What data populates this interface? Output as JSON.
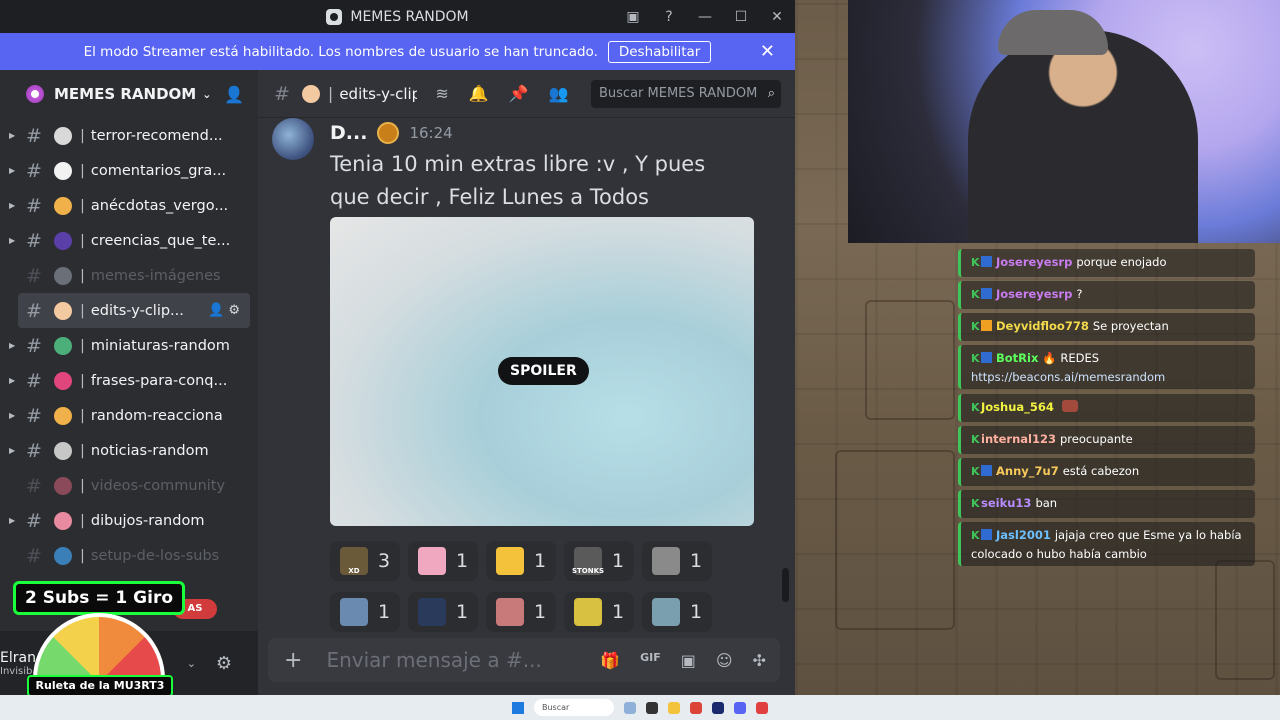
{
  "window": {
    "title": "MEMES RANDOM",
    "controls": [
      "▣",
      "?",
      "—",
      "☐",
      "✕"
    ]
  },
  "streamer_bar": {
    "message": "El modo Streamer está habilitado. Los nombres de usuario se han truncado.",
    "button": "Deshabilitar"
  },
  "server": {
    "name": "MEMES RANDOM"
  },
  "channels": [
    {
      "name": "terror-recomend...",
      "emoji_color": "#d9d9d9",
      "muted": false,
      "active": false
    },
    {
      "name": "comentarios_gra...",
      "emoji_color": "#f2f2f2",
      "muted": false,
      "active": false
    },
    {
      "name": "anécdotas_vergo...",
      "emoji_color": "#f0b04a",
      "muted": false,
      "active": false
    },
    {
      "name": "creencias_que_te...",
      "emoji_color": "#5b3fa8",
      "muted": false,
      "active": false
    },
    {
      "name": "memes-imágenes",
      "emoji_color": "#6b6f78",
      "muted": true,
      "active": false
    },
    {
      "name": "edits-y-clip...",
      "emoji_color": "#f2c9a0",
      "muted": false,
      "active": true
    },
    {
      "name": "miniaturas-random",
      "emoji_color": "#4caf7a",
      "muted": false,
      "active": false
    },
    {
      "name": "frases-para-conq...",
      "emoji_color": "#e0457b",
      "muted": false,
      "active": false
    },
    {
      "name": "random-reacciona",
      "emoji_color": "#f0b04a",
      "muted": false,
      "active": false
    },
    {
      "name": "noticias-random",
      "emoji_color": "#c7c7c7",
      "muted": false,
      "active": false
    },
    {
      "name": "videos-community",
      "emoji_color": "#8a4a5a",
      "muted": true,
      "active": false
    },
    {
      "name": "dibujos-random",
      "emoji_color": "#e88aa0",
      "muted": false,
      "active": false
    },
    {
      "name": "setup-de-los-subs",
      "emoji_color": "#3a7fb8",
      "muted": true,
      "active": false
    }
  ],
  "user": {
    "name": "Elran",
    "status": "Invisib"
  },
  "header": {
    "channel": "edits-y-clip",
    "search_placeholder": "Buscar MEMES RANDOM"
  },
  "message": {
    "author": "D...",
    "time": "16:24",
    "text": "Tenia 10 min extras libre :v , Y pues que decir , Feliz Lunes a Todos",
    "spoiler_label": "SPOILER"
  },
  "reactions": [
    {
      "count": "3",
      "color": "#6b5a3a",
      "label": "XD"
    },
    {
      "count": "1",
      "color": "#f0a8c0",
      "label": ""
    },
    {
      "count": "1",
      "color": "#f5c33b",
      "label": ""
    },
    {
      "count": "1",
      "color": "#5a5a5a",
      "label": "STONKS"
    },
    {
      "count": "1",
      "color": "#8a8a8a",
      "label": ""
    },
    {
      "count": "1",
      "color": "#6a8ab0",
      "label": ""
    },
    {
      "count": "1",
      "color": "#2a3a5a",
      "label": ""
    },
    {
      "count": "1",
      "color": "#c87a7a",
      "label": ""
    },
    {
      "count": "1",
      "color": "#d8c040",
      "label": ""
    },
    {
      "count": "1",
      "color": "#7aa0b0",
      "label": ""
    }
  ],
  "composer": {
    "placeholder": "Enviar mensaje a #..."
  },
  "twitch_chat": [
    {
      "user": "Josereyesrp",
      "user_color": "#c87cf0",
      "text": "porque enojado",
      "badge_color": "#2f6bd1"
    },
    {
      "user": "Josereyesrp",
      "user_color": "#c87cf0",
      "text": "?",
      "badge_color": "#2f6bd1"
    },
    {
      "user": "Deyvidfloo778",
      "user_color": "#f2d94a",
      "text": "Se proyectan",
      "badge_color": "#f0a020"
    },
    {
      "user": "BotRix",
      "user_color": "#5cff5c",
      "text": "🔥 REDES",
      "link": "https://beacons.ai/memesrandom",
      "badge_color": "#2f6bd1"
    },
    {
      "user": "Joshua_564",
      "user_color": "#f2f240",
      "text": "",
      "badge_color": ""
    },
    {
      "user": "internal123",
      "user_color": "#ffb0a0",
      "text": "preocupante",
      "badge_color": ""
    },
    {
      "user": "Anny_7u7",
      "user_color": "#f7c95a",
      "text": "está cabezon",
      "badge_color": "#2f6bd1"
    },
    {
      "user": "seiku13",
      "user_color": "#b78cff",
      "text": "ban",
      "badge_color": ""
    },
    {
      "user": "Jasl2001",
      "user_color": "#6cc0ff",
      "text": "jajaja creo que Esme ya lo había colocado o hubo había cambio",
      "badge_color": "#2f6bd1"
    }
  ],
  "roulette": {
    "top": "2 Subs = 1 Giro",
    "bottom": "Ruleta de la MU3RT3"
  },
  "taskbar": {
    "search": "Buscar"
  }
}
